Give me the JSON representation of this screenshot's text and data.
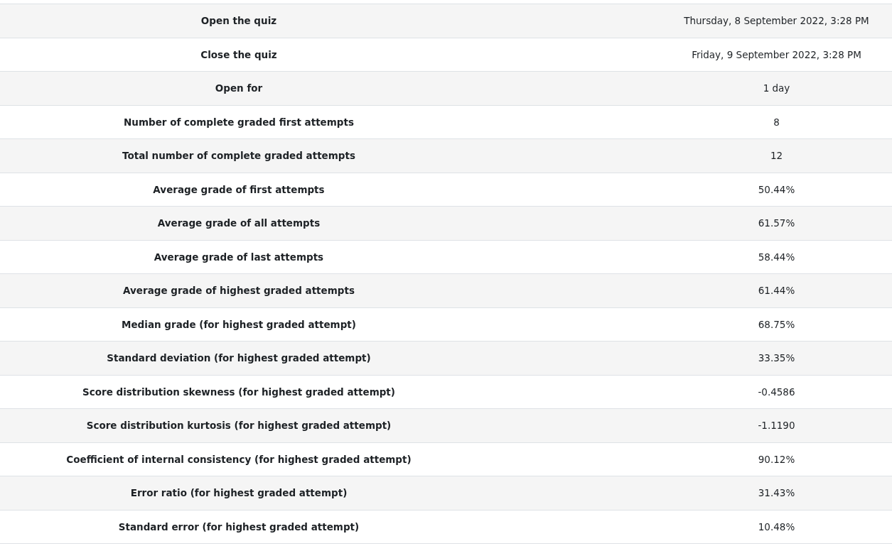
{
  "rows": [
    {
      "label": "Open the quiz",
      "value": "Thursday, 8 September 2022, 3:28 PM"
    },
    {
      "label": "Close the quiz",
      "value": "Friday, 9 September 2022, 3:28 PM"
    },
    {
      "label": "Open for",
      "value": "1 day"
    },
    {
      "label": "Number of complete graded first attempts",
      "value": "8"
    },
    {
      "label": "Total number of complete graded attempts",
      "value": "12"
    },
    {
      "label": "Average grade of first attempts",
      "value": "50.44%"
    },
    {
      "label": "Average grade of all attempts",
      "value": "61.57%"
    },
    {
      "label": "Average grade of last attempts",
      "value": "58.44%"
    },
    {
      "label": "Average grade of highest graded attempts",
      "value": "61.44%"
    },
    {
      "label": "Median grade (for highest graded attempt)",
      "value": "68.75%"
    },
    {
      "label": "Standard deviation (for highest graded attempt)",
      "value": "33.35%"
    },
    {
      "label": "Score distribution skewness (for highest graded attempt)",
      "value": "-0.4586"
    },
    {
      "label": "Score distribution kurtosis (for highest graded attempt)",
      "value": "-1.1190"
    },
    {
      "label": "Coefficient of internal consistency (for highest graded attempt)",
      "value": "90.12%"
    },
    {
      "label": "Error ratio (for highest graded attempt)",
      "value": "31.43%"
    },
    {
      "label": "Standard error (for highest graded attempt)",
      "value": "10.48%"
    }
  ]
}
